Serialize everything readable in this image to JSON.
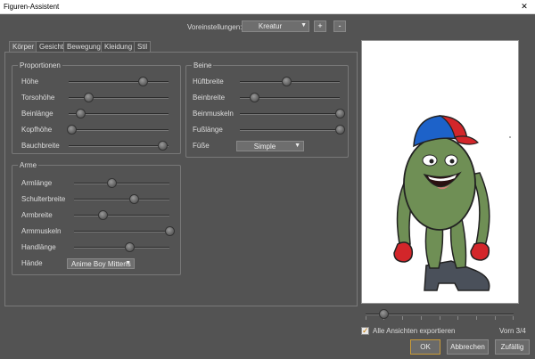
{
  "window": {
    "title": "Figuren-Assistent",
    "close_glyph": "✕"
  },
  "presets": {
    "label": "Voreinstellungen:",
    "value": "Kreatur",
    "add": "+",
    "remove": "-"
  },
  "tabs": [
    "Körper",
    "Gesicht",
    "Bewegung",
    "Kleidung",
    "Stil"
  ],
  "active_tab": "Körper",
  "proportions": {
    "title": "Proportionen",
    "sliders": [
      {
        "label": "Höhe",
        "value": 0.74
      },
      {
        "label": "Torsohöhe",
        "value": 0.2
      },
      {
        "label": "Beinlänge",
        "value": 0.12
      },
      {
        "label": "Kopfhöhe",
        "value": 0.03
      },
      {
        "label": "Bauchbreite",
        "value": 0.94
      }
    ]
  },
  "legs": {
    "title": "Beine",
    "sliders": [
      {
        "label": "Hüftbreite",
        "value": 0.46
      },
      {
        "label": "Beinbreite",
        "value": 0.14
      },
      {
        "label": "Beinmuskeln",
        "value": 1.0
      },
      {
        "label": "Fußlänge",
        "value": 1.0
      }
    ],
    "feet_label": "Füße",
    "feet_value": "Simple"
  },
  "arms": {
    "title": "Arme",
    "sliders": [
      {
        "label": "Armlänge",
        "value": 0.39
      },
      {
        "label": "Schulterbreite",
        "value": 0.63
      },
      {
        "label": "Armbreite",
        "value": 0.3
      },
      {
        "label": "Armmuskeln",
        "value": 1.0
      },
      {
        "label": "Handlänge",
        "value": 0.58
      }
    ],
    "hands_label": "Hände",
    "hands_value": "Anime Boy Mittens"
  },
  "view": {
    "position": 0.12,
    "counter": "Vorn 3/4"
  },
  "export_all": {
    "label": "Alle Ansichten exportieren",
    "checked": true
  },
  "buttons": {
    "ok": "OK",
    "cancel": "Abbrechen",
    "random": "Zufällig"
  },
  "icons": {
    "dropdown": "▼",
    "check": "✓"
  }
}
